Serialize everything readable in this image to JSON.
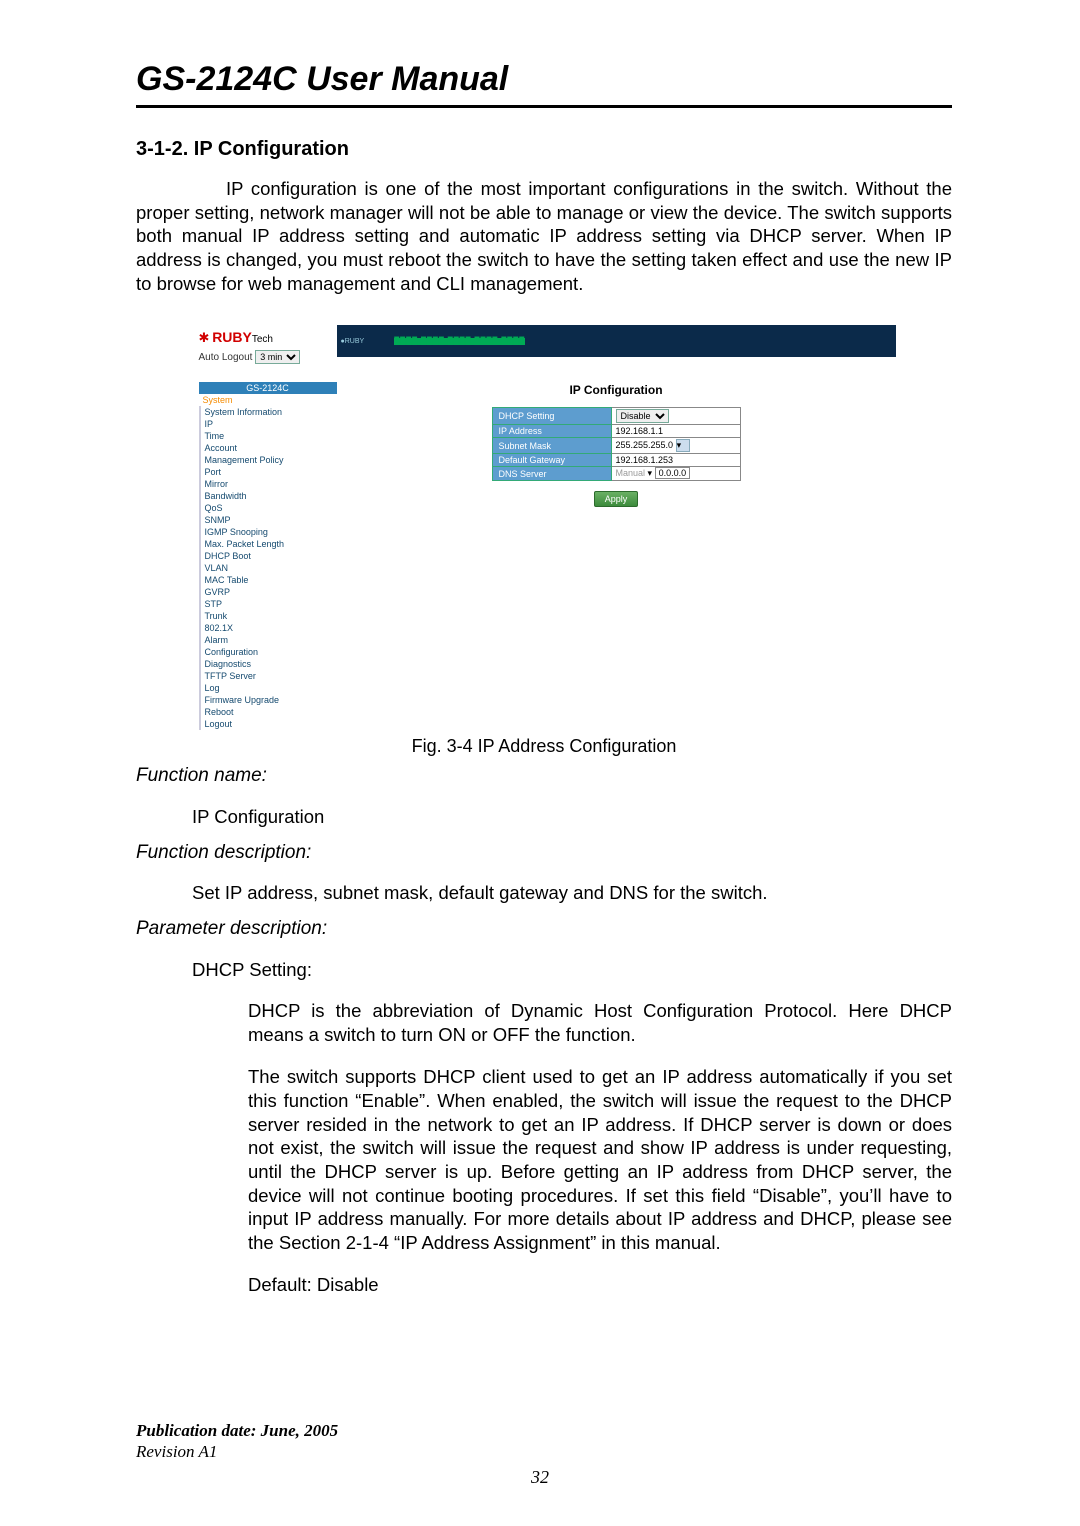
{
  "doc": {
    "title": "GS-2124C User Manual",
    "section_num": "3-1-2. IP Configuration",
    "intro": "IP configuration is one of the most important configurations in the switch. Without the proper setting, network manager will not be able to manage or view the device. The switch supports both manual IP address setting and automatic IP address setting via DHCP server. When IP address is changed, you must reboot the switch to have the setting taken effect and use the new IP to browse for web management and CLI management.",
    "caption": "Fig. 3-4 IP Address Configuration",
    "fn_name_label": "Function name:",
    "fn_name_val": "IP Configuration",
    "fn_desc_label": "Function description:",
    "fn_desc_val": "Set IP address, subnet mask, default gateway and DNS for the switch.",
    "param_label": "Parameter description:",
    "param_name": "DHCP Setting:",
    "param_p1": "DHCP is the abbreviation of Dynamic Host Configuration Protocol. Here DHCP means a switch to turn ON or OFF the function.",
    "param_p2": "The switch supports DHCP client used to get an IP address automatically if you set this function “Enable”. When enabled, the switch will issue the request to the DHCP server resided in the network to get an IP address. If DHCP server is down or does not exist, the switch will issue the request and show IP address is under requesting, until the DHCP server is up. Before getting an IP address from DHCP server, the device will not continue booting procedures. If set this field “Disable”, you’ll have to input IP address manually. For more details about IP address and DHCP, please see the Section 2-1-4 “IP Address Assignment” in this manual.",
    "param_default": "Default:  Disable",
    "pub_line1": "Publication date: June, 2005",
    "pub_line2": "Revision A1",
    "page_number": "32"
  },
  "ui": {
    "brand": "RUBY",
    "brand_sub": "Tech",
    "auto_logout_label": "Auto Logout",
    "auto_logout_value": "3 min",
    "sidebar_model": "GS-2124C",
    "sidebar_system": "System",
    "sidebar_items": [
      "System Information",
      "IP",
      "Time",
      "Account",
      "Management Policy",
      "Port",
      "Mirror",
      "Bandwidth",
      "QoS",
      "SNMP",
      "IGMP Snooping",
      "Max. Packet Length",
      "DHCP Boot",
      "VLAN",
      "MAC Table",
      "GVRP",
      "STP",
      "Trunk",
      "802.1X",
      "Alarm",
      "Configuration",
      "Diagnostics",
      "TFTP Server",
      "Log",
      "Firmware Upgrade",
      "Reboot",
      "Logout"
    ],
    "content_title": "IP Configuration",
    "rows": {
      "dhcp_label": "DHCP Setting",
      "dhcp_value": "Disable",
      "ip_label": "IP Address",
      "ip_value": "192.168.1.1",
      "mask_label": "Subnet Mask",
      "mask_value": "255.255.255.0",
      "gw_label": "Default Gateway",
      "gw_value": "192.168.1.253",
      "dns_label": "DNS Server",
      "dns_mode": "Manual",
      "dns_value": "0.0.0.0"
    },
    "apply_label": "Apply"
  }
}
